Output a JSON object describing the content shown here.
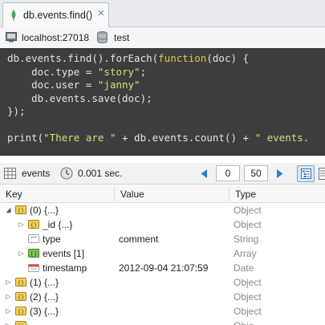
{
  "tab": {
    "title": "db.events.find()",
    "close_label": "×"
  },
  "connection": {
    "server": "localhost:27018",
    "database": "test"
  },
  "editor": {
    "lines": [
      [
        {
          "t": "db.events.find().forEach(",
          "c": ""
        },
        {
          "t": "function",
          "c": "kw"
        },
        {
          "t": "(doc) {",
          "c": ""
        }
      ],
      [
        {
          "t": "    doc.type = ",
          "c": ""
        },
        {
          "t": "\"story\"",
          "c": "str"
        },
        {
          "t": ";",
          "c": ""
        }
      ],
      [
        {
          "t": "    doc.user = ",
          "c": ""
        },
        {
          "t": "\"janny\"",
          "c": "str"
        },
        {
          "t": "",
          "c": ""
        }
      ],
      [
        {
          "t": "    db.events.save(doc);",
          "c": ""
        }
      ],
      [
        {
          "t": "});",
          "c": ""
        }
      ],
      [
        {
          "t": "",
          "c": ""
        }
      ],
      [
        {
          "t": "print(",
          "c": ""
        },
        {
          "t": "\"There are \"",
          "c": "str"
        },
        {
          "t": " + db.events.count() + ",
          "c": ""
        },
        {
          "t": "\" events.",
          "c": "str"
        }
      ]
    ]
  },
  "toolbar": {
    "collection": "events",
    "time": "0.001 sec.",
    "skip": "0",
    "limit": "50"
  },
  "table": {
    "headers": {
      "key": "Key",
      "value": "Value",
      "type": "Type"
    },
    "rows": [
      {
        "key": "(0) {...}",
        "value": "",
        "type": "Object",
        "indent": 0,
        "expander": "open",
        "icon": "object"
      },
      {
        "key": "_id {...}",
        "value": "",
        "type": "Object",
        "indent": 1,
        "expander": "closed",
        "icon": "object"
      },
      {
        "key": "type",
        "value": "comment",
        "type": "String",
        "indent": 1,
        "expander": "none",
        "icon": "string"
      },
      {
        "key": "events [1]",
        "value": "",
        "type": "Array",
        "indent": 1,
        "expander": "closed",
        "icon": "array"
      },
      {
        "key": "timestamp",
        "value": "2012-09-04 21:07:59",
        "type": "Date",
        "indent": 1,
        "expander": "none",
        "icon": "date"
      },
      {
        "key": "(1) {...}",
        "value": "",
        "type": "Object",
        "indent": 0,
        "expander": "closed",
        "icon": "object"
      },
      {
        "key": "(2) {...}",
        "value": "",
        "type": "Object",
        "indent": 0,
        "expander": "closed",
        "icon": "object"
      },
      {
        "key": "(3) {...}",
        "value": "",
        "type": "Object",
        "indent": 0,
        "expander": "closed",
        "icon": "object"
      },
      {
        "key": "",
        "value": "",
        "type": "Obje",
        "indent": 0,
        "expander": "closed",
        "icon": "object"
      }
    ]
  },
  "colors": {
    "editor_bg": "#3d3d3d",
    "keyword": "#e7c547",
    "string": "#cde37d",
    "object_icon": "#e8c04a",
    "array_icon": "#6fb94f"
  }
}
